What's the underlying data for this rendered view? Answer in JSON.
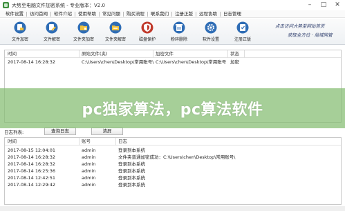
{
  "window": {
    "title": "大势至电脑文件加密系统 - 专业版本：V2.0",
    "controls": [
      "–",
      "□",
      "✕"
    ]
  },
  "menu": [
    "软件设置",
    "访问首网",
    "软件介绍",
    "使用帮助",
    "常见问题",
    "购买流程",
    "联系我们",
    "注册正版",
    "远程协助",
    "日志管理"
  ],
  "toolbar": {
    "buttons": [
      {
        "label": "文件加密",
        "icon": "file-lock-icon",
        "color": "#2f6db5"
      },
      {
        "label": "文件解密",
        "icon": "file-unlock-icon",
        "color": "#2f6db5"
      },
      {
        "label": "文件夹加密",
        "icon": "folder-lock-icon",
        "color": "#2f6db5"
      },
      {
        "label": "文件夹解密",
        "icon": "folder-unlock-icon",
        "color": "#2f6db5"
      },
      {
        "label": "磁盘保护",
        "icon": "disk-shield-icon",
        "color": "#c0392b"
      },
      {
        "label": "粉碎删除",
        "icon": "shred-icon",
        "color": "#2f6db5"
      },
      {
        "label": "软件设置",
        "icon": "gear-icon",
        "color": "#2f6db5"
      },
      {
        "label": "注册正版",
        "icon": "register-icon",
        "color": "#2f6db5"
      }
    ],
    "slogan": {
      "line1": "点击访问大势至网站首页",
      "line2": "获取全方位 · 局域网管"
    }
  },
  "files_table": {
    "headers": [
      "时间",
      "原始文件(夹)",
      "加密文件",
      "状态"
    ],
    "rows": [
      [
        "2017-08-14 16:28:32",
        "C:\\Users\\chen\\Desktop\\常用账号\\",
        "C:\\Users\\chen\\Desktop\\常用账号",
        "加密"
      ]
    ]
  },
  "log": {
    "label": "日志列表:",
    "query_button": "查询日志",
    "clear_button": "清屏",
    "headers": [
      "时间",
      "账号",
      "日志"
    ],
    "rows": [
      [
        "2017-08-15 12:04:01",
        "admin",
        "登录到本系统"
      ],
      [
        "2017-08-14 16:28:32",
        "admin",
        "文件夹普通加密成功：C:\\Users\\chen\\Desktop\\常用账号\\"
      ],
      [
        "2017-08-14 16:28:32",
        "admin",
        "登录到本系统"
      ],
      [
        "2017-08-14 16:25:36",
        "admin",
        "登录到本系统"
      ],
      [
        "2017-08-14 12:42:51",
        "admin",
        "登录到本系统"
      ],
      [
        "2017-08-14 12:29:42",
        "admin",
        "登录到本系统"
      ]
    ]
  },
  "overlay": {
    "text": "pc独家算法，pc算法软件",
    "color": "#84bc70"
  }
}
